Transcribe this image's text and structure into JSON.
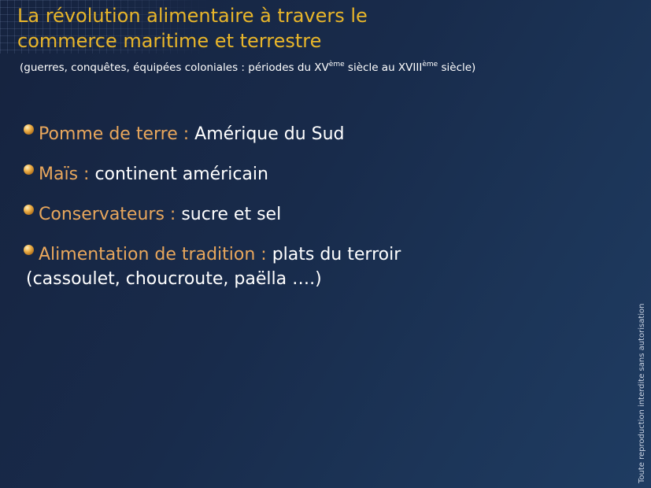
{
  "title": {
    "line1": "La révolution alimentaire à travers le",
    "line2": "commerce maritime et terrestre"
  },
  "subtitle": {
    "part1": "(guerres, conquêtes, équipées coloniales : périodes du XV",
    "sup1": "ème",
    "part2": " siècle au XVIII",
    "sup2": "ème",
    "part3": " siècle)"
  },
  "items": [
    {
      "key": "Pomme de terre : ",
      "value": "Amérique du Sud"
    },
    {
      "key": "Maïs : ",
      "value": "continent américain"
    },
    {
      "key": "Conservateurs : ",
      "value": "sucre et sel"
    },
    {
      "key": "Alimentation de tradition : ",
      "value": "plats du terroir",
      "continuation": "(cassoulet, choucroute, paëlla ….)"
    }
  ],
  "footer": {
    "vertical_note": "Toute reproduction interdite sans autorisation"
  },
  "colors": {
    "title": "#e9b62a",
    "key": "#e9a75c",
    "text": "#ffffff",
    "background": "#182b4b"
  }
}
